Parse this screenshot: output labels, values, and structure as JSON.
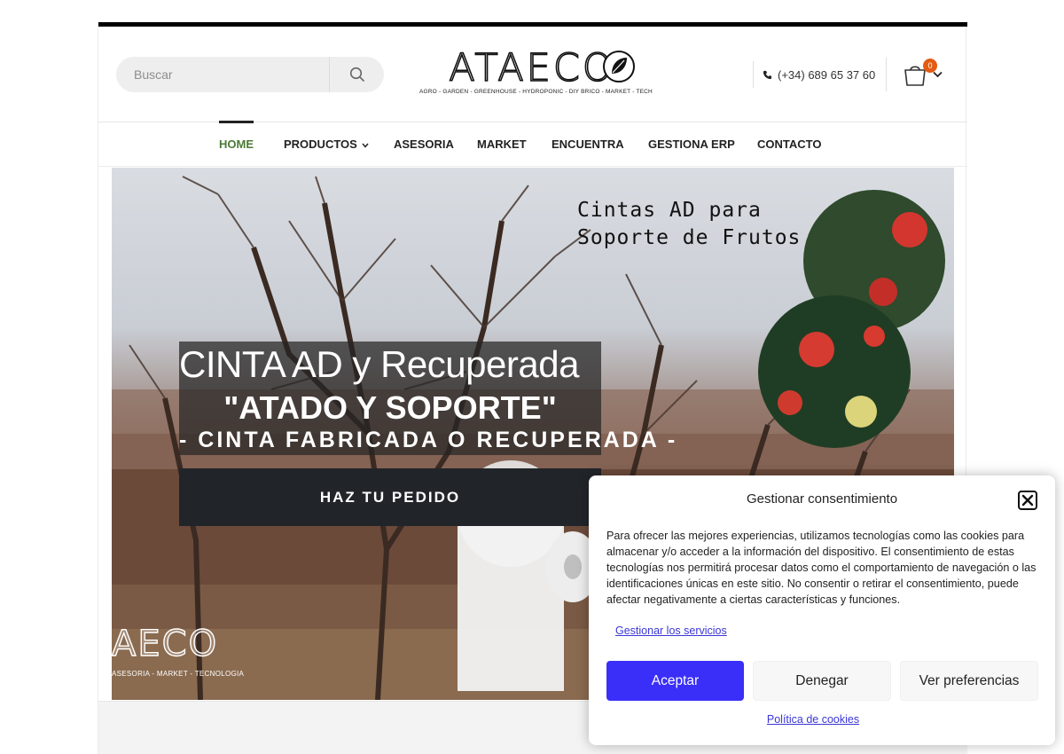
{
  "header": {
    "search_placeholder": "Buscar",
    "logo_text": "ATAECO",
    "logo_tagline": "AGRO - GARDEN - GREENHOUSE - HYDROPONIC - DIY BRICO - MARKET - TECH",
    "phone": "(+34) 689 65 37 60",
    "cart_count": "0"
  },
  "nav": {
    "items": [
      {
        "label": "HOME",
        "active": true
      },
      {
        "label": "PRODUCTOS"
      },
      {
        "label": "ASESORIA"
      },
      {
        "label": "MARKET"
      },
      {
        "label": "ENCUENTRA"
      },
      {
        "label": "GESTIONA ERP"
      },
      {
        "label": "CONTACTO"
      }
    ]
  },
  "hero": {
    "title": "CINTA AD y Recuperada",
    "subtitle": "\"ATADO Y SOPORTE\"",
    "subtitle2": "- CINTA FABRICADA O RECUPERADA -",
    "button": "HAZ TU PEDIDO",
    "tagline": "Cintas AD para\nSoporte de Frutos",
    "logo_text": "AECO",
    "logo_tag": "ASESORIA - MARKET - TECNOLOGIA"
  },
  "consent": {
    "title": "Gestionar consentimiento",
    "text": "Para ofrecer las mejores experiencias, utilizamos tecnologías como las cookies para almacenar y/o acceder a la información del dispositivo. El consentimiento de estas tecnologías nos permitirá procesar datos como el comportamiento de navegación o las identificaciones únicas en este sitio. No consentir o retirar el consentimiento, puede afectar negativamente a ciertas características y funciones.",
    "manage_link": "Gestionar los servicios",
    "accept": "Aceptar",
    "deny": "Denegar",
    "preferences": "Ver preferencias",
    "policy_link": "Política de cookies"
  },
  "colors": {
    "accent": "#3a2ff8",
    "nav_active": "#4b7a34",
    "badge": "#e35b12",
    "button_dark": "#21252a"
  }
}
